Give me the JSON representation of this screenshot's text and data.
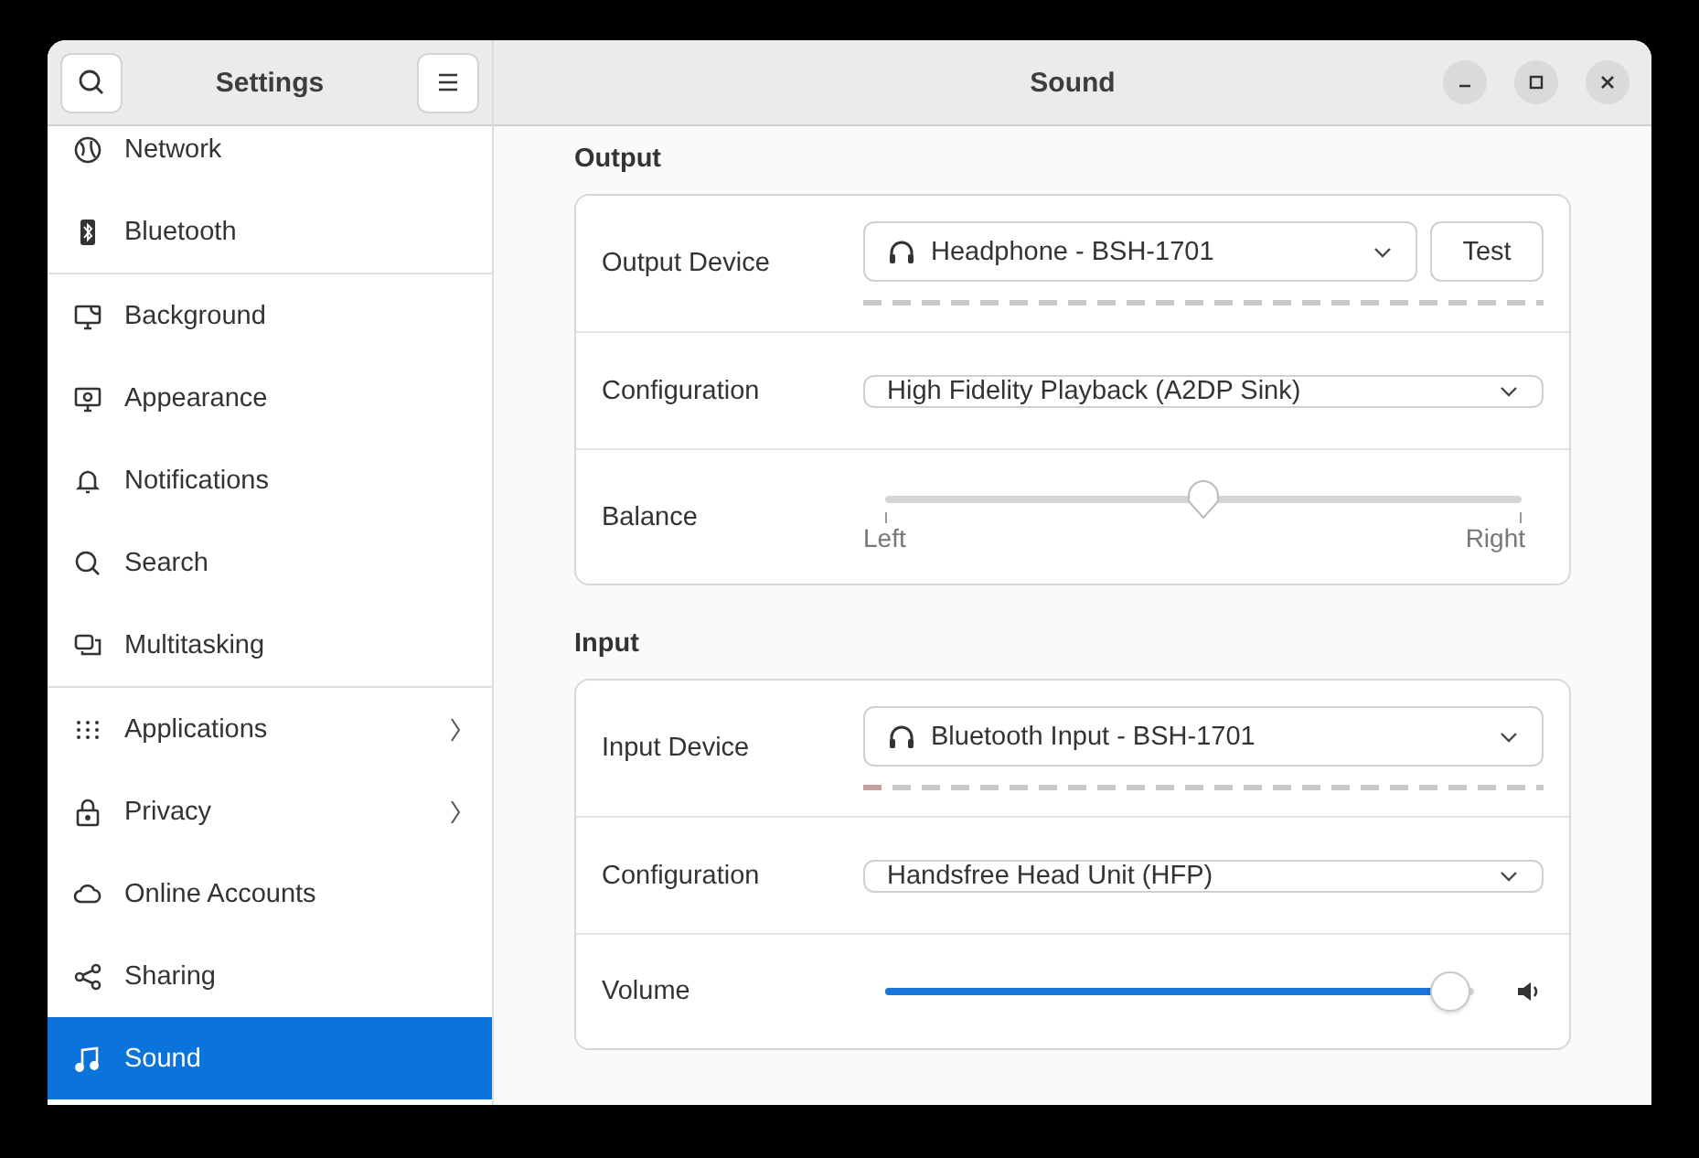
{
  "sidebar": {
    "title": "Settings",
    "items": [
      {
        "label": "Network",
        "selected": false,
        "divider_after": false,
        "submenu": false
      },
      {
        "label": "Bluetooth",
        "selected": false,
        "divider_after": true,
        "submenu": false
      },
      {
        "label": "Background",
        "selected": false,
        "divider_after": false,
        "submenu": false
      },
      {
        "label": "Appearance",
        "selected": false,
        "divider_after": false,
        "submenu": false
      },
      {
        "label": "Notifications",
        "selected": false,
        "divider_after": false,
        "submenu": false
      },
      {
        "label": "Search",
        "selected": false,
        "divider_after": false,
        "submenu": false
      },
      {
        "label": "Multitasking",
        "selected": false,
        "divider_after": true,
        "submenu": false
      },
      {
        "label": "Applications",
        "selected": false,
        "divider_after": false,
        "submenu": true
      },
      {
        "label": "Privacy",
        "selected": false,
        "divider_after": false,
        "submenu": true
      },
      {
        "label": "Online Accounts",
        "selected": false,
        "divider_after": false,
        "submenu": false
      },
      {
        "label": "Sharing",
        "selected": false,
        "divider_after": false,
        "submenu": false
      },
      {
        "label": "Sound",
        "selected": true,
        "divider_after": false,
        "submenu": false
      }
    ]
  },
  "window": {
    "title": "Sound"
  },
  "sections": [
    {
      "title": "Output",
      "rows": [
        {
          "kind": "device",
          "label": "Output Device",
          "value": "Headphone - BSH-1701",
          "button": "Test",
          "meter": {
            "level": 0
          }
        },
        {
          "kind": "select",
          "label": "Configuration",
          "value": "High Fidelity Playback (A2DP Sink)"
        },
        {
          "kind": "balance",
          "label": "Balance",
          "level": 0.5,
          "left": "Left",
          "right": "Right"
        }
      ]
    },
    {
      "title": "Input",
      "rows": [
        {
          "kind": "device",
          "label": "Input Device",
          "value": "Bluetooth Input - BSH-1701",
          "meter": {
            "level": 0.03
          }
        },
        {
          "kind": "select",
          "label": "Configuration",
          "value": "Handsfree Head Unit (HFP)"
        },
        {
          "kind": "volume",
          "label": "Volume",
          "level": 0.96
        }
      ]
    }
  ]
}
